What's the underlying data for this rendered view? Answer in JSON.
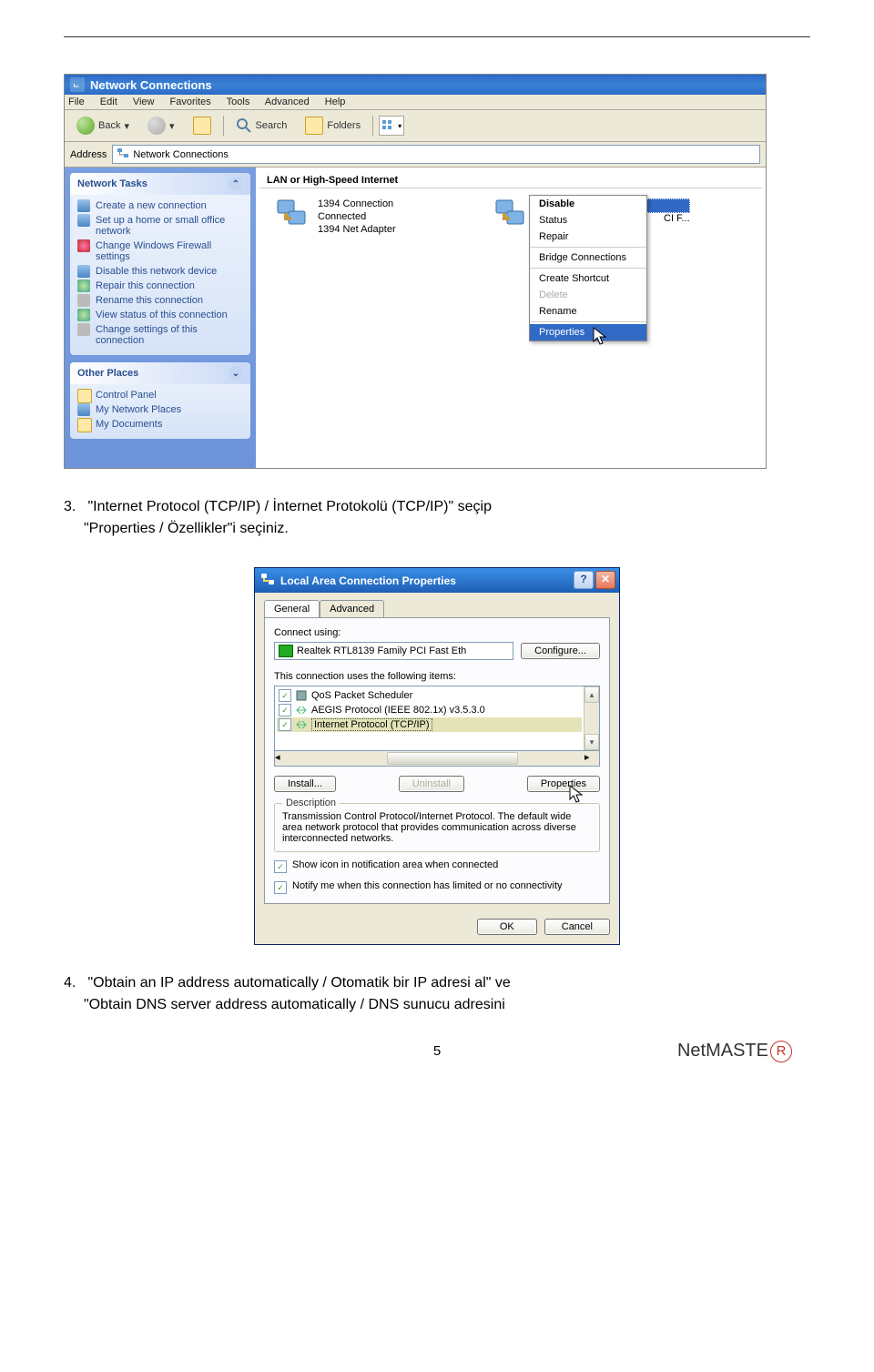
{
  "screenshot1": {
    "title": "Network Connections",
    "menus": [
      "File",
      "Edit",
      "View",
      "Favorites",
      "Tools",
      "Advanced",
      "Help"
    ],
    "toolbar": {
      "back": "Back",
      "search": "Search",
      "folders": "Folders"
    },
    "address": {
      "label": "Address",
      "value": "Network Connections"
    },
    "sidebar": {
      "tasks": {
        "title": "Network Tasks",
        "items": [
          "Create a new connection",
          "Set up a home or small office network",
          "Change Windows Firewall settings",
          "Disable this network device",
          "Repair this connection",
          "Rename this connection",
          "View status of this connection",
          "Change settings of this connection"
        ]
      },
      "other": {
        "title": "Other Places",
        "items": [
          "Control Panel",
          "My Network Places",
          "My Documents"
        ]
      }
    },
    "content": {
      "category": "LAN or High-Speed Internet",
      "item1": {
        "name": "1394 Connection",
        "status": "Connected",
        "device": "1394 Net Adapter"
      },
      "item2": {
        "name": "Local Area Connection",
        "ellipsis": "CI F..."
      }
    },
    "context_menu": {
      "disable": "Disable",
      "status": "Status",
      "repair": "Repair",
      "bridge": "Bridge Connections",
      "shortcut": "Create Shortcut",
      "delete": "Delete",
      "rename": "Rename",
      "properties": "Properties"
    }
  },
  "para3": {
    "num": "3.",
    "text1": "\"Internet Protocol (TCP/IP) / İnternet Protokolü (TCP/IP)\" seçip ",
    "text2": "\"Properties / Özellikler\"i seçiniz."
  },
  "dialog": {
    "title": "Local Area Connection Properties",
    "tabs": {
      "general": "General",
      "advanced": "Advanced"
    },
    "connect_label": "Connect using:",
    "adapter": "Realtek RTL8139 Family PCI Fast Eth",
    "configure": "Configure...",
    "uses_label": "This connection uses the following items:",
    "items": [
      "QoS Packet Scheduler",
      "AEGIS Protocol (IEEE 802.1x) v3.5.3.0",
      "Internet Protocol (TCP/IP)"
    ],
    "install": "Install...",
    "uninstall": "Uninstall",
    "properties": "Properties",
    "desc_title": "Description",
    "desc_text": "Transmission Control Protocol/Internet Protocol. The default wide area network protocol that provides communication across diverse interconnected networks.",
    "chk1": "Show icon in notification area when connected",
    "chk2": "Notify me when this connection has limited or no connectivity",
    "ok": "OK",
    "cancel": "Cancel"
  },
  "para4": {
    "num": "4.",
    "text1": "\"Obtain an IP address automatically / Otomatik bir IP adresi al\" ve ",
    "text2": "\"Obtain DNS server address automatically / DNS sunucu adresini"
  },
  "footer": {
    "page": "5",
    "brand": "NetMASTE",
    "brand_r": "R"
  }
}
